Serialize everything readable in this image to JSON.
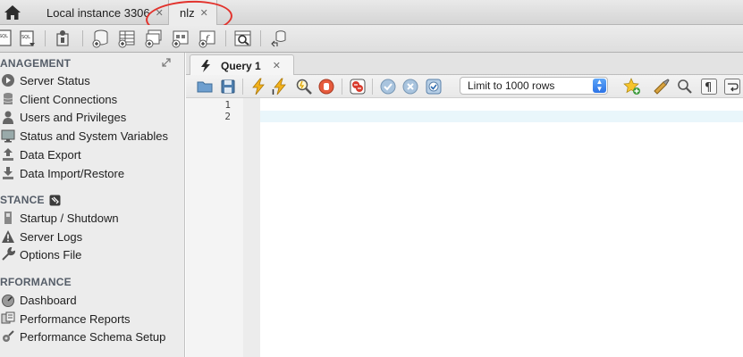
{
  "tabs": {
    "home_icon": "home-icon",
    "connections": [
      {
        "label": "Local instance 3306",
        "close": "✕"
      },
      {
        "label": "nlz",
        "close": "✕"
      }
    ]
  },
  "annotation": {
    "color": "#e2322c"
  },
  "sidebar": {
    "sections": [
      {
        "title": "ANAGEMENT",
        "items": [
          {
            "label": "Server Status",
            "icon": "server-status-icon"
          },
          {
            "label": "Client Connections",
            "icon": "client-connections-icon"
          },
          {
            "label": "Users and Privileges",
            "icon": "user-icon"
          },
          {
            "label": "Status and System Variables",
            "icon": "monitor-icon"
          },
          {
            "label": "Data Export",
            "icon": "export-icon"
          },
          {
            "label": "Data Import/Restore",
            "icon": "import-icon"
          }
        ]
      },
      {
        "title": "STANCE",
        "items": [
          {
            "label": "Startup / Shutdown",
            "icon": "startup-icon"
          },
          {
            "label": "Server Logs",
            "icon": "warning-icon"
          },
          {
            "label": "Options File",
            "icon": "wrench-icon"
          }
        ]
      },
      {
        "title": "RFORMANCE",
        "items": [
          {
            "label": "Dashboard",
            "icon": "dashboard-icon"
          },
          {
            "label": "Performance Reports",
            "icon": "reports-icon"
          },
          {
            "label": "Performance Schema Setup",
            "icon": "schema-setup-icon"
          }
        ]
      }
    ]
  },
  "editor": {
    "query_tab": {
      "label": "Query 1",
      "close": "✕"
    },
    "limit_select": {
      "value": "Limit to 1000 rows"
    },
    "line_numbers": [
      "1",
      "2"
    ]
  }
}
